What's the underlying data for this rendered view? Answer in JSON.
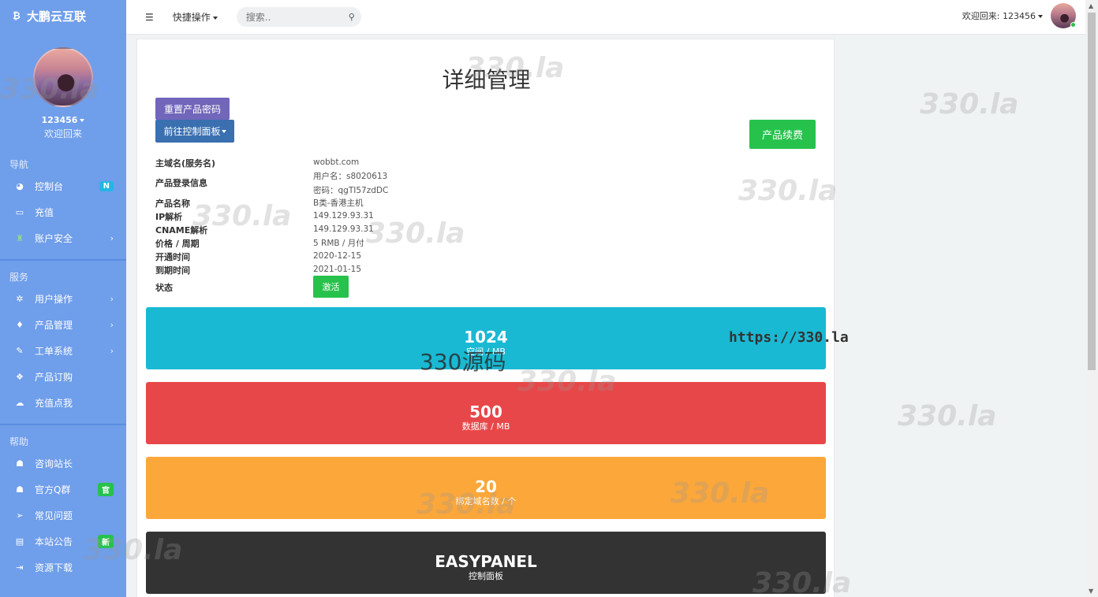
{
  "sidebar": {
    "brand": "大鹏云互联",
    "username": "123456",
    "welcome": "欢迎回来",
    "sections": {
      "nav": "导航",
      "service": "服务",
      "help": "帮助"
    },
    "items": [
      {
        "label": "控制台",
        "badge": "N"
      },
      {
        "label": "充值"
      },
      {
        "label": "账户安全"
      },
      {
        "label": "用户操作"
      },
      {
        "label": "产品管理"
      },
      {
        "label": "工单系统"
      },
      {
        "label": "产品订购"
      },
      {
        "label": "充值点我"
      },
      {
        "label": "咨询站长"
      },
      {
        "label": "官方Q群",
        "badge": "官"
      },
      {
        "label": "常见问题"
      },
      {
        "label": "本站公告",
        "badge": "新"
      },
      {
        "label": "资源下载"
      }
    ]
  },
  "topbar": {
    "quick_label": "快捷操作",
    "search_placeholder": "搜索..",
    "welcome": "欢迎回来: 123456"
  },
  "main": {
    "title": "详细管理",
    "reset_btn": "重置产品密码",
    "cp_btn": "前往控制面板",
    "renew_btn": "产品续费",
    "labels": {
      "domain": "主域名(服务名)",
      "login": "产品登录信息",
      "product": "产品名称",
      "ip": "IP解析",
      "cname": "CNAME解析",
      "price": "价格 / 周期",
      "open": "开通时间",
      "expire": "到期时间",
      "status": "状态"
    },
    "values": {
      "domain": "wobbt.com",
      "username": "用户名：s8020613",
      "password": "密码：qgTI57zdDC",
      "product": "B类-香港主机",
      "ip": "149.129.93.31",
      "cname": "149.129.93.31",
      "price": "5 RMB / 月付",
      "open": "2020-12-15",
      "expire": "2021-01-15",
      "status": "激活"
    },
    "cards": [
      {
        "num": "1024",
        "sub": "空间 / MB",
        "color": "#19b9d3"
      },
      {
        "num": "500",
        "sub": "数据库 / MB",
        "color": "#e84749"
      },
      {
        "num": "20",
        "sub": "绑定域名数 / 个",
        "color": "#fca73a"
      },
      {
        "num": "EASYPANEL",
        "sub": "控制面板",
        "color": "#333333"
      }
    ]
  },
  "watermark": {
    "text": "330.la",
    "url": "https://330.la",
    "logo": "330源码"
  }
}
